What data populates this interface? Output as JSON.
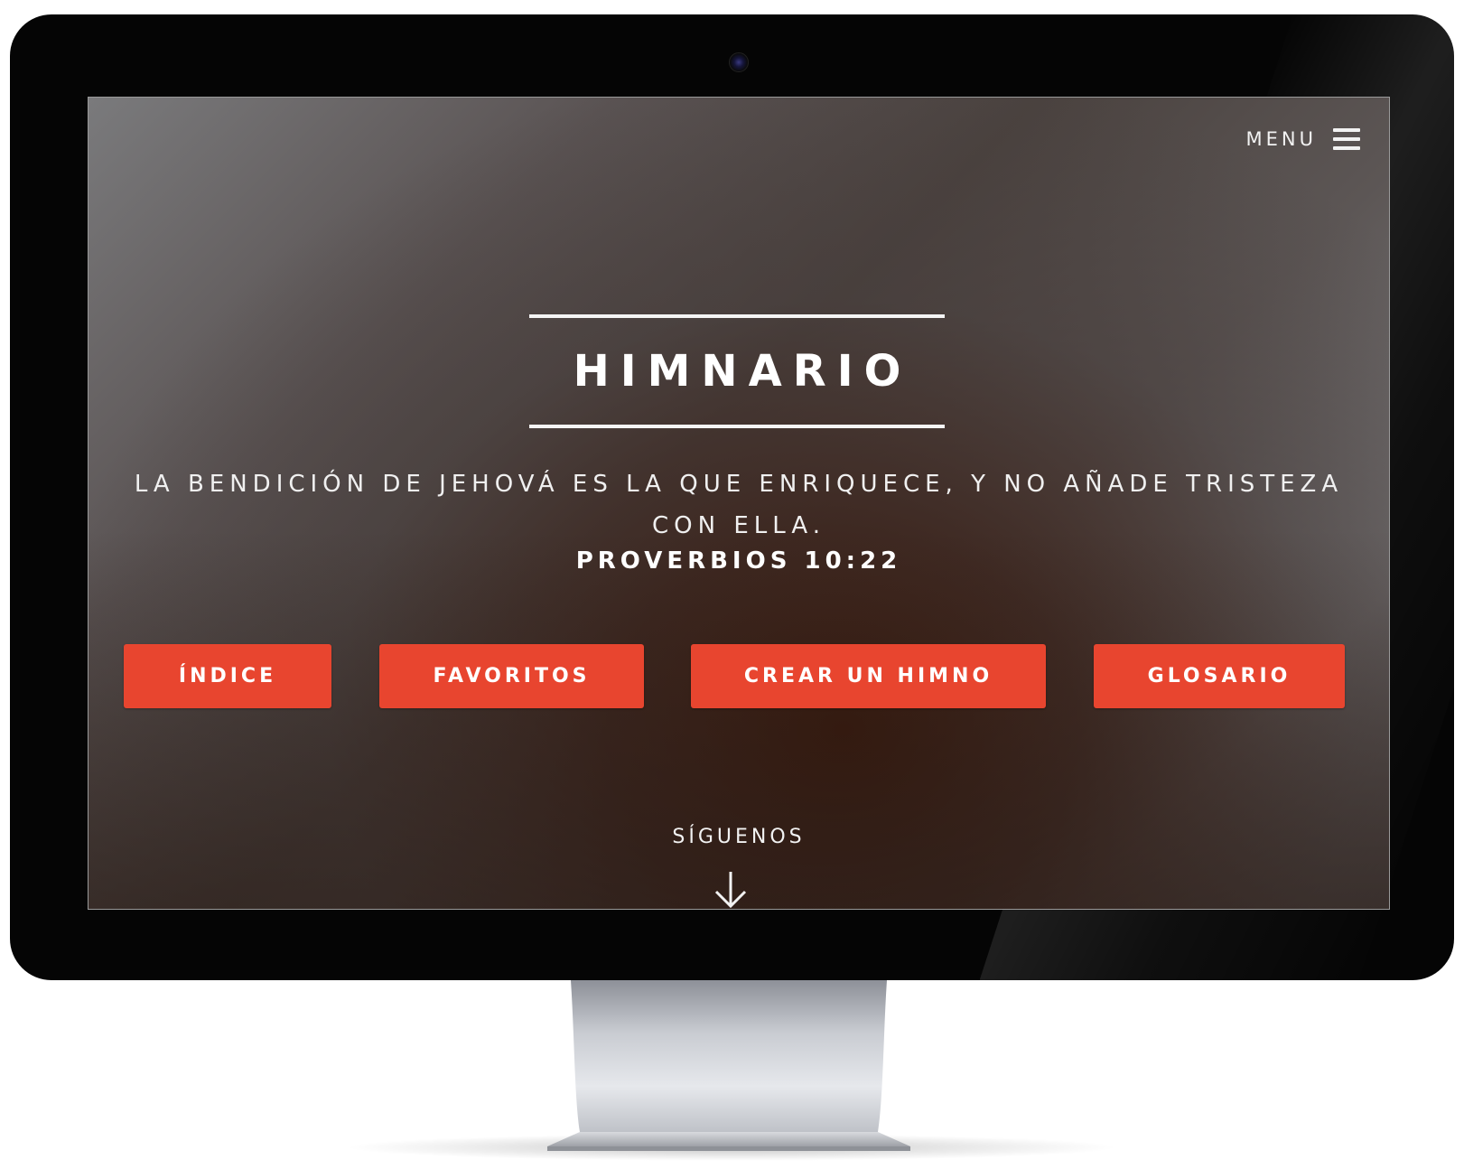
{
  "menu": {
    "label": "MENU",
    "icon": "hamburger-icon"
  },
  "hero": {
    "title": "HIMNARIO",
    "verse_line1": "LA BENDICIÓN DE JEHOVÁ ES LA QUE ENRIQUECE, Y NO AÑADE TRISTEZA",
    "verse_line2": "CON ELLA.",
    "reference": "PROVERBIOS 10:22"
  },
  "buttons": [
    {
      "label": "ÍNDICE"
    },
    {
      "label": "FAVORITOS"
    },
    {
      "label": "CREAR UN HIMNO"
    },
    {
      "label": "GLOSARIO"
    }
  ],
  "follow": {
    "label": "SÍGUENOS",
    "icon": "arrow-down-icon"
  },
  "colors": {
    "button_bg": "#e8452f",
    "text": "#ffffff",
    "bezel": "#050505"
  }
}
